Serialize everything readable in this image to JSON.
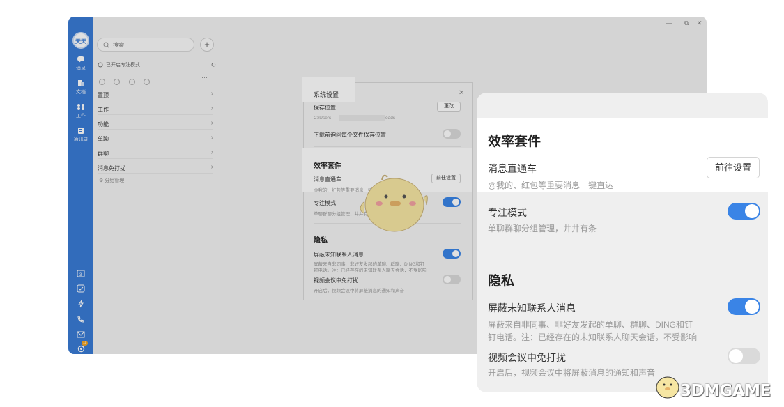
{
  "rail": {
    "logo_text": "天天",
    "items": [
      {
        "label": "消息",
        "icon": "chat-icon"
      },
      {
        "label": "文档",
        "icon": "document-icon"
      },
      {
        "label": "工作",
        "icon": "grid-icon"
      },
      {
        "label": "通讯录",
        "icon": "contacts-icon"
      }
    ],
    "badge": "11"
  },
  "list": {
    "search_placeholder": "搜索",
    "focus_mode_text": "已开启专注模式",
    "groups": [
      "置顶",
      "工作",
      "功能",
      "单聊",
      "群聊",
      "消息免打扰"
    ],
    "manage_text": "分组管理"
  },
  "dialog": {
    "title": "系统设置",
    "save_location_label": "保存位置",
    "change_button": "更改",
    "path_prefix": "C:\\Users",
    "path_suffix": "oads",
    "ask_location_label": "下载前询问每个文件保存位置",
    "efficiency_heading": "效率套件",
    "express_label": "消息直通车",
    "express_desc": "@我的、红包等重要消息一键直达",
    "goto_settings_button": "前往设置",
    "focus_label": "专注模式",
    "focus_desc": "单聊群聊分组管理，井井有条",
    "privacy_heading": "隐私",
    "block_label": "屏蔽未知联系人消息",
    "block_desc_1": "屏蔽来自非同事、非好友发起的单聊、群聊、DING和钉",
    "block_desc_2": "钉电话。注：已经存在的未知联系人聊天会话，不受影响",
    "video_label": "视频会议中免打扰",
    "video_desc": "开启后，视频会议中将屏蔽消息的通知和声音"
  },
  "zoom": {
    "efficiency_heading": "效率套件",
    "express_label": "消息直通车",
    "express_desc": "@我的、红包等重要消息一键直达",
    "goto_settings_button": "前往设置",
    "focus_label": "专注模式",
    "focus_desc": "单聊群聊分组管理，井井有条",
    "privacy_heading": "隐私",
    "block_label": "屏蔽未知联系人消息",
    "block_desc_1": "屏蔽来自非同事、非好友发起的单聊、群聊、DING和钉",
    "block_desc_2": "钉电话。注：已经存在的未知联系人聊天会话，不受影响",
    "video_label": "视频会议中免打扰",
    "video_desc": "开启后，视频会议中将屏蔽消息的通知和声音"
  },
  "toggles": {
    "ask_location": "off",
    "focus_mode": "on",
    "block_unknown": "on",
    "video_dnd": "off"
  },
  "watermark": {
    "text": "3DMGAME"
  },
  "colors": {
    "accent": "#3a84e6",
    "rail": "#3a7bd5"
  }
}
